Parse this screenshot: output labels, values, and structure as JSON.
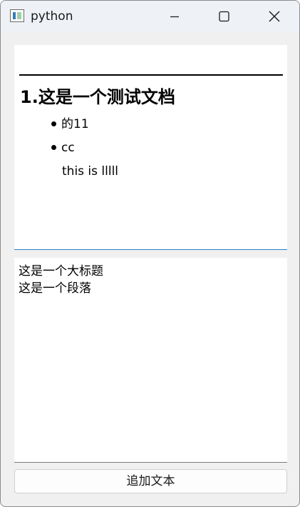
{
  "window": {
    "title": "python"
  },
  "document": {
    "heading": "1.这是一个测试文档",
    "bullets": [
      "的11",
      "cc"
    ],
    "plain_line": "this is lllll"
  },
  "text_area": {
    "lines": [
      "这是一个大标题",
      "这是一个段落"
    ]
  },
  "buttons": {
    "append_label": "追加文本"
  },
  "icons": {
    "app": "python-app-icon",
    "minimize": "minimize-icon",
    "maximize": "maximize-icon",
    "close": "close-icon"
  },
  "colors": {
    "titlebar": "#eef2f7",
    "window_bg": "#f0f0f0",
    "focus_accent": "#2d7fbe"
  }
}
